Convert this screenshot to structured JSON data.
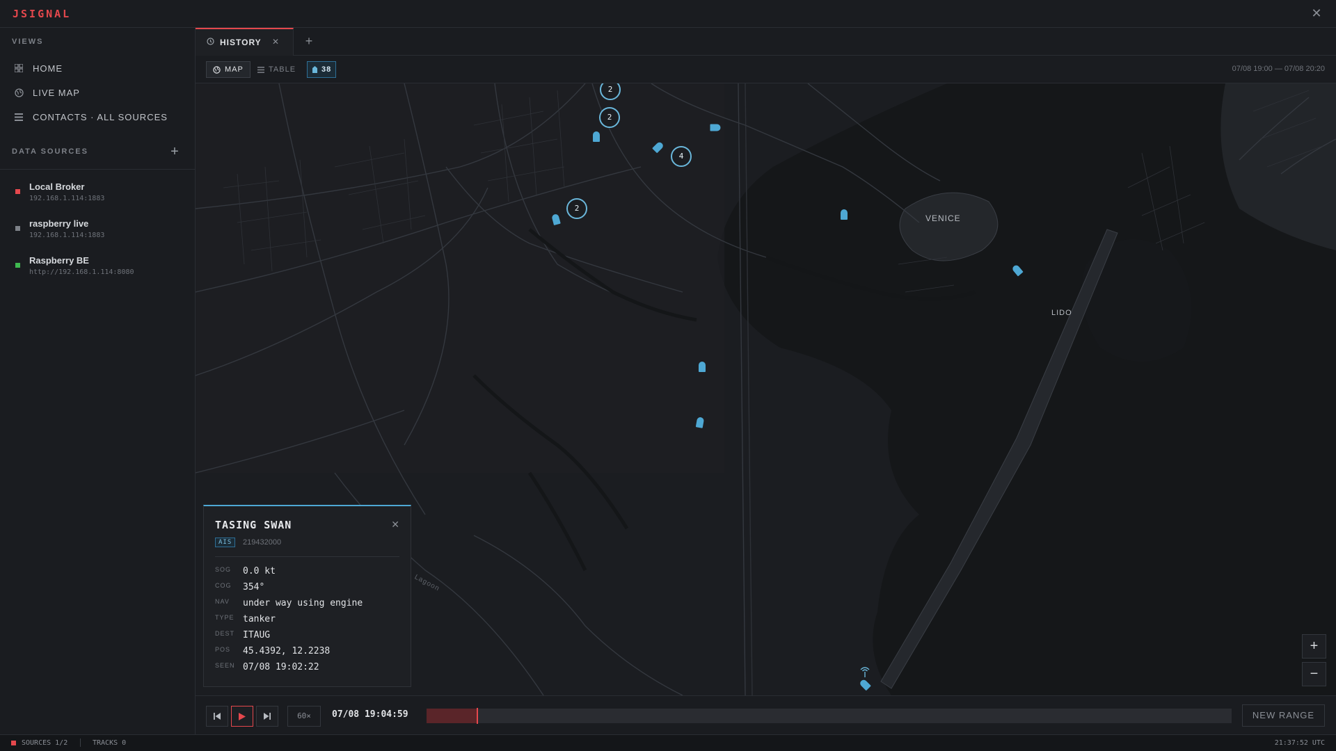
{
  "app": {
    "logo": "JSIGNAL",
    "close_glyph": "✕"
  },
  "sidebar": {
    "views_title": "VIEWS",
    "views": [
      {
        "label": "HOME",
        "icon": "grid-icon"
      },
      {
        "label": "LIVE MAP",
        "icon": "globe-icon"
      },
      {
        "label": "CONTACTS · ALL SOURCES",
        "icon": "list-icon"
      }
    ],
    "data_sources_title": "DATA SOURCES",
    "add_glyph": "+",
    "sources": [
      {
        "name": "Local Broker",
        "address": "192.168.1.114:1883",
        "status_color": "#e5484d"
      },
      {
        "name": "raspberry live",
        "address": "192.168.1.114:1883",
        "status_color": "#7d8188"
      },
      {
        "name": "Raspberry BE",
        "address": "http://192.168.1.114:8080",
        "status_color": "#3fb950"
      }
    ]
  },
  "tabs": {
    "active_label": "HISTORY",
    "close_glyph": "✕",
    "add_glyph": "+"
  },
  "toolbar": {
    "map_label": "MAP",
    "table_label": "TABLE",
    "count": "38",
    "time_range": "07/08 19:00 — 07/08 20:20"
  },
  "map": {
    "accent_color": "#4ea8d4",
    "places": {
      "venice": "VENICE",
      "lido": "LIDO",
      "lagoon": "Lagoon"
    },
    "clusters": [
      "2",
      "2",
      "4",
      "2"
    ],
    "zoom_in": "+",
    "zoom_out": "−"
  },
  "popup": {
    "title": "TASING SWAN",
    "badge": "AIS",
    "mmsi": "219432000",
    "close_glyph": "✕",
    "fields": [
      {
        "key": "SOG",
        "value": "0.0 kt"
      },
      {
        "key": "COG",
        "value": "354°"
      },
      {
        "key": "NAV",
        "value": "under way using engine"
      },
      {
        "key": "TYPE",
        "value": "tanker"
      },
      {
        "key": "DEST",
        "value": "ITAUG"
      },
      {
        "key": "POS",
        "value": "45.4392, 12.2238"
      },
      {
        "key": "SEEN",
        "value": "07/08 19:02:22"
      }
    ]
  },
  "playback": {
    "speed": "60×",
    "current_time": "07/08 19:04:59",
    "progress": 0.063,
    "new_range_label": "NEW RANGE"
  },
  "status": {
    "sources": "SOURCES 1/2",
    "tracks": "TRACKS 0",
    "clock": "21:37:52 UTC"
  }
}
